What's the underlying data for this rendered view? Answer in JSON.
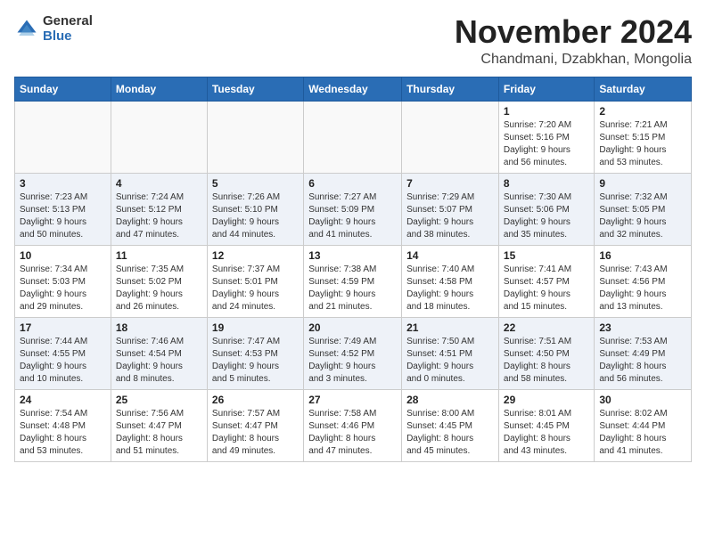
{
  "header": {
    "logo_general": "General",
    "logo_blue": "Blue",
    "month_title": "November 2024",
    "location": "Chandmani, Dzabkhan, Mongolia"
  },
  "days_of_week": [
    "Sunday",
    "Monday",
    "Tuesday",
    "Wednesday",
    "Thursday",
    "Friday",
    "Saturday"
  ],
  "weeks": [
    [
      {
        "day": "",
        "info": ""
      },
      {
        "day": "",
        "info": ""
      },
      {
        "day": "",
        "info": ""
      },
      {
        "day": "",
        "info": ""
      },
      {
        "day": "",
        "info": ""
      },
      {
        "day": "1",
        "info": "Sunrise: 7:20 AM\nSunset: 5:16 PM\nDaylight: 9 hours\nand 56 minutes."
      },
      {
        "day": "2",
        "info": "Sunrise: 7:21 AM\nSunset: 5:15 PM\nDaylight: 9 hours\nand 53 minutes."
      }
    ],
    [
      {
        "day": "3",
        "info": "Sunrise: 7:23 AM\nSunset: 5:13 PM\nDaylight: 9 hours\nand 50 minutes."
      },
      {
        "day": "4",
        "info": "Sunrise: 7:24 AM\nSunset: 5:12 PM\nDaylight: 9 hours\nand 47 minutes."
      },
      {
        "day": "5",
        "info": "Sunrise: 7:26 AM\nSunset: 5:10 PM\nDaylight: 9 hours\nand 44 minutes."
      },
      {
        "day": "6",
        "info": "Sunrise: 7:27 AM\nSunset: 5:09 PM\nDaylight: 9 hours\nand 41 minutes."
      },
      {
        "day": "7",
        "info": "Sunrise: 7:29 AM\nSunset: 5:07 PM\nDaylight: 9 hours\nand 38 minutes."
      },
      {
        "day": "8",
        "info": "Sunrise: 7:30 AM\nSunset: 5:06 PM\nDaylight: 9 hours\nand 35 minutes."
      },
      {
        "day": "9",
        "info": "Sunrise: 7:32 AM\nSunset: 5:05 PM\nDaylight: 9 hours\nand 32 minutes."
      }
    ],
    [
      {
        "day": "10",
        "info": "Sunrise: 7:34 AM\nSunset: 5:03 PM\nDaylight: 9 hours\nand 29 minutes."
      },
      {
        "day": "11",
        "info": "Sunrise: 7:35 AM\nSunset: 5:02 PM\nDaylight: 9 hours\nand 26 minutes."
      },
      {
        "day": "12",
        "info": "Sunrise: 7:37 AM\nSunset: 5:01 PM\nDaylight: 9 hours\nand 24 minutes."
      },
      {
        "day": "13",
        "info": "Sunrise: 7:38 AM\nSunset: 4:59 PM\nDaylight: 9 hours\nand 21 minutes."
      },
      {
        "day": "14",
        "info": "Sunrise: 7:40 AM\nSunset: 4:58 PM\nDaylight: 9 hours\nand 18 minutes."
      },
      {
        "day": "15",
        "info": "Sunrise: 7:41 AM\nSunset: 4:57 PM\nDaylight: 9 hours\nand 15 minutes."
      },
      {
        "day": "16",
        "info": "Sunrise: 7:43 AM\nSunset: 4:56 PM\nDaylight: 9 hours\nand 13 minutes."
      }
    ],
    [
      {
        "day": "17",
        "info": "Sunrise: 7:44 AM\nSunset: 4:55 PM\nDaylight: 9 hours\nand 10 minutes."
      },
      {
        "day": "18",
        "info": "Sunrise: 7:46 AM\nSunset: 4:54 PM\nDaylight: 9 hours\nand 8 minutes."
      },
      {
        "day": "19",
        "info": "Sunrise: 7:47 AM\nSunset: 4:53 PM\nDaylight: 9 hours\nand 5 minutes."
      },
      {
        "day": "20",
        "info": "Sunrise: 7:49 AM\nSunset: 4:52 PM\nDaylight: 9 hours\nand 3 minutes."
      },
      {
        "day": "21",
        "info": "Sunrise: 7:50 AM\nSunset: 4:51 PM\nDaylight: 9 hours\nand 0 minutes."
      },
      {
        "day": "22",
        "info": "Sunrise: 7:51 AM\nSunset: 4:50 PM\nDaylight: 8 hours\nand 58 minutes."
      },
      {
        "day": "23",
        "info": "Sunrise: 7:53 AM\nSunset: 4:49 PM\nDaylight: 8 hours\nand 56 minutes."
      }
    ],
    [
      {
        "day": "24",
        "info": "Sunrise: 7:54 AM\nSunset: 4:48 PM\nDaylight: 8 hours\nand 53 minutes."
      },
      {
        "day": "25",
        "info": "Sunrise: 7:56 AM\nSunset: 4:47 PM\nDaylight: 8 hours\nand 51 minutes."
      },
      {
        "day": "26",
        "info": "Sunrise: 7:57 AM\nSunset: 4:47 PM\nDaylight: 8 hours\nand 49 minutes."
      },
      {
        "day": "27",
        "info": "Sunrise: 7:58 AM\nSunset: 4:46 PM\nDaylight: 8 hours\nand 47 minutes."
      },
      {
        "day": "28",
        "info": "Sunrise: 8:00 AM\nSunset: 4:45 PM\nDaylight: 8 hours\nand 45 minutes."
      },
      {
        "day": "29",
        "info": "Sunrise: 8:01 AM\nSunset: 4:45 PM\nDaylight: 8 hours\nand 43 minutes."
      },
      {
        "day": "30",
        "info": "Sunrise: 8:02 AM\nSunset: 4:44 PM\nDaylight: 8 hours\nand 41 minutes."
      }
    ]
  ]
}
